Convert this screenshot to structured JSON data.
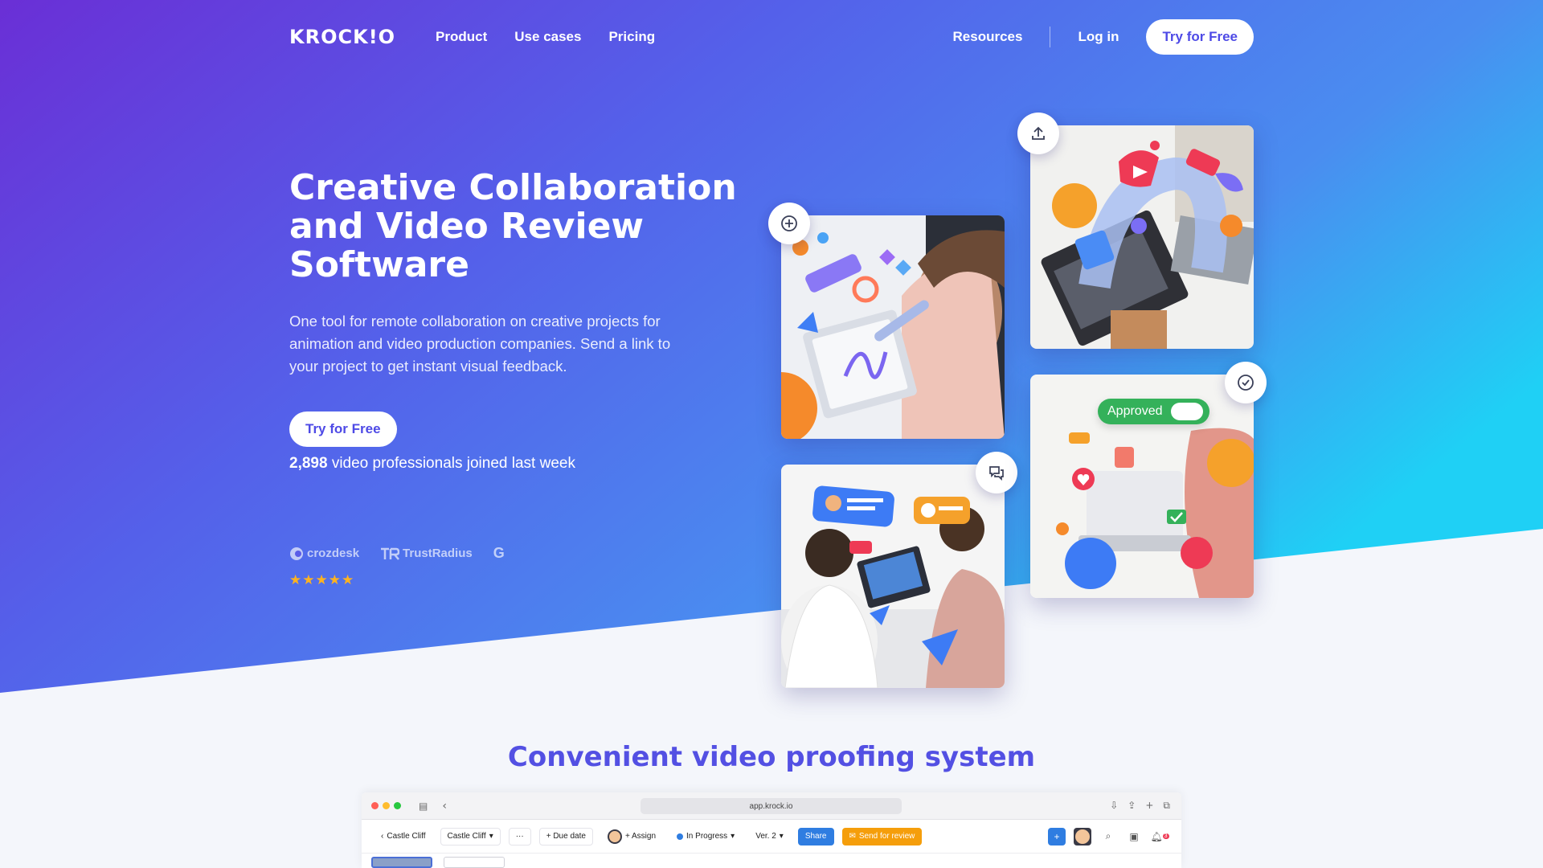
{
  "nav": {
    "logo": "KROCK!O",
    "links": [
      "Product",
      "Use cases",
      "Pricing"
    ],
    "resources": "Resources",
    "login": "Log in",
    "cta": "Try for Free"
  },
  "hero": {
    "title": "Creative Collaboration and Video Review Software",
    "subtitle": "One tool for remote collaboration on creative projects for animation and video production companies. Send a link to your project to get instant visual feedback.",
    "cta": "Try for Free",
    "count_number": "2,898",
    "count_text": "video professionals joined last week",
    "badges": [
      "crozdesk",
      "TrustRadius",
      "G"
    ],
    "stars": "★★★★★",
    "rating_stars": 5
  },
  "cards": {
    "approved_label": "Approved",
    "icons": [
      "plus-circle-icon",
      "upload-icon",
      "comments-icon",
      "check-circle-icon"
    ]
  },
  "section": {
    "title": "Convenient video proofing system"
  },
  "browser": {
    "url": "app.krock.io",
    "toolbar": {
      "back_label": "Castle Cliff",
      "project_select": "Castle Cliff",
      "more": "···",
      "due_date": "+ Due date",
      "assign": "+ Assign",
      "status": "In Progress",
      "version": "Ver. 2",
      "share": "Share",
      "send_review": "Send for review",
      "notification_count": "3"
    }
  },
  "colors": {
    "brand": "#5350e3",
    "gradient_start": "#6a2fd6",
    "gradient_end": "#1fd0f5",
    "star": "#ffb320",
    "share": "#2f7de1",
    "review": "#f59e0b"
  }
}
